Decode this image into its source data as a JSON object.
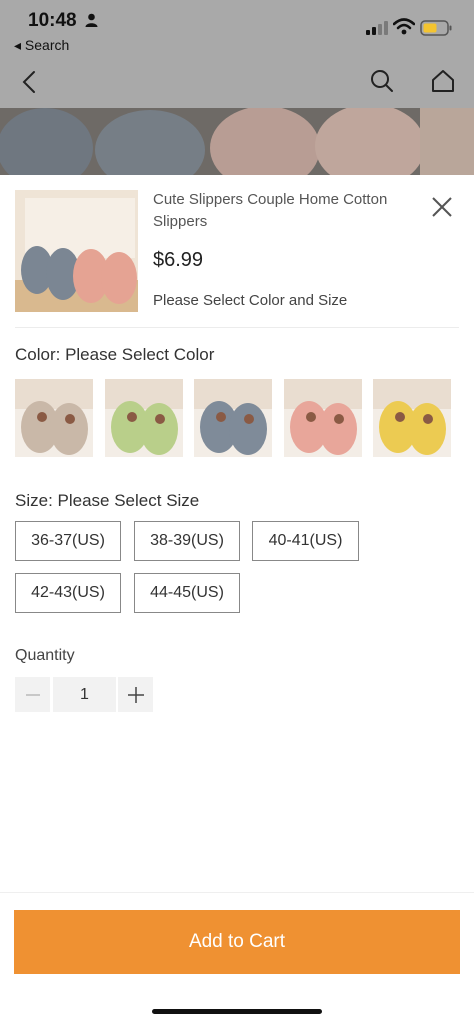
{
  "status_bar": {
    "time": "10:48",
    "back_app_label": "◂ Search"
  },
  "product": {
    "title": "Cute Slippers Couple Home Cotton Slippers",
    "price": "$6.99",
    "select_hint": "Please Select Color and Size"
  },
  "color": {
    "label": "Color: Please Select Color",
    "options": [
      {
        "name": "gray-brown",
        "color": "#c9b8a8"
      },
      {
        "name": "green",
        "color": "#b9cf8a"
      },
      {
        "name": "gray-blue",
        "color": "#7f8b99"
      },
      {
        "name": "pink",
        "color": "#e8a69a"
      },
      {
        "name": "yellow",
        "color": "#eccb52"
      }
    ]
  },
  "size": {
    "label": "Size: Please Select Size",
    "options": [
      "36-37(US)",
      "38-39(US)",
      "40-41(US)",
      "42-43(US)",
      "44-45(US)"
    ]
  },
  "quantity": {
    "label": "Quantity",
    "value": "1"
  },
  "cart": {
    "add_label": "Add to Cart",
    "accent": "#ef9132"
  },
  "icons": [
    "person-icon",
    "signal-icon",
    "wifi-icon",
    "battery-icon",
    "back-chevron-icon",
    "search-icon",
    "home-icon",
    "close-icon",
    "minus-icon",
    "plus-icon"
  ]
}
